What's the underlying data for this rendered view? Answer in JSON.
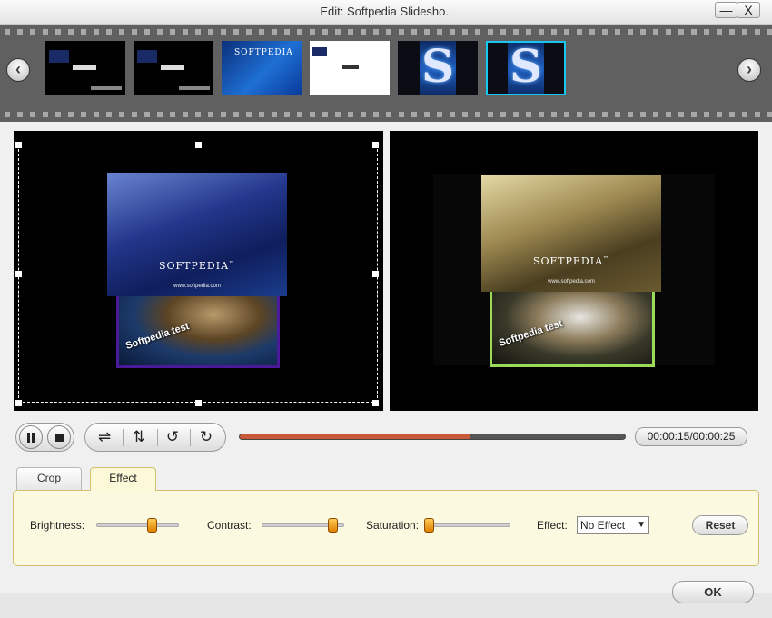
{
  "window": {
    "title": "Edit: Softpedia Slidesho..",
    "minimize_label": "—",
    "close_label": "X"
  },
  "filmstrip": {
    "prev_label": "‹",
    "next_label": "›",
    "thumb3_logo": "SOFTPEDIA",
    "selected_index": 5,
    "selected_border_color": "#19c6f0"
  },
  "preview": {
    "brand": "SOFTPEDIA",
    "brand_tm": "™",
    "url": "www.softpedia.com",
    "tag": "Softpedia test"
  },
  "playback": {
    "pause_icon": "pause-icon",
    "stop_icon": "stop-icon",
    "flip_h_label": "⇌",
    "flip_v_label": "⇅",
    "rotate_ccw_label": "↺",
    "rotate_cw_label": "↻",
    "progress": 0.6,
    "progress_color": "#c85a3a",
    "time": "00:00:15/00:00:25"
  },
  "tabs": [
    {
      "label": "Crop"
    },
    {
      "label": "Effect"
    }
  ],
  "effect_panel": {
    "brightness_label": "Brightness:",
    "brightness_value": 0.67,
    "contrast_label": "Contrast:",
    "contrast_value": 0.87,
    "saturation_label": "Saturation:",
    "saturation_value": 0.02,
    "effect_label": "Effect:",
    "effect_selected": "No Effect",
    "reset_label": "Reset",
    "accent_color": "#f0a020"
  },
  "footer": {
    "ok_label": "OK"
  }
}
